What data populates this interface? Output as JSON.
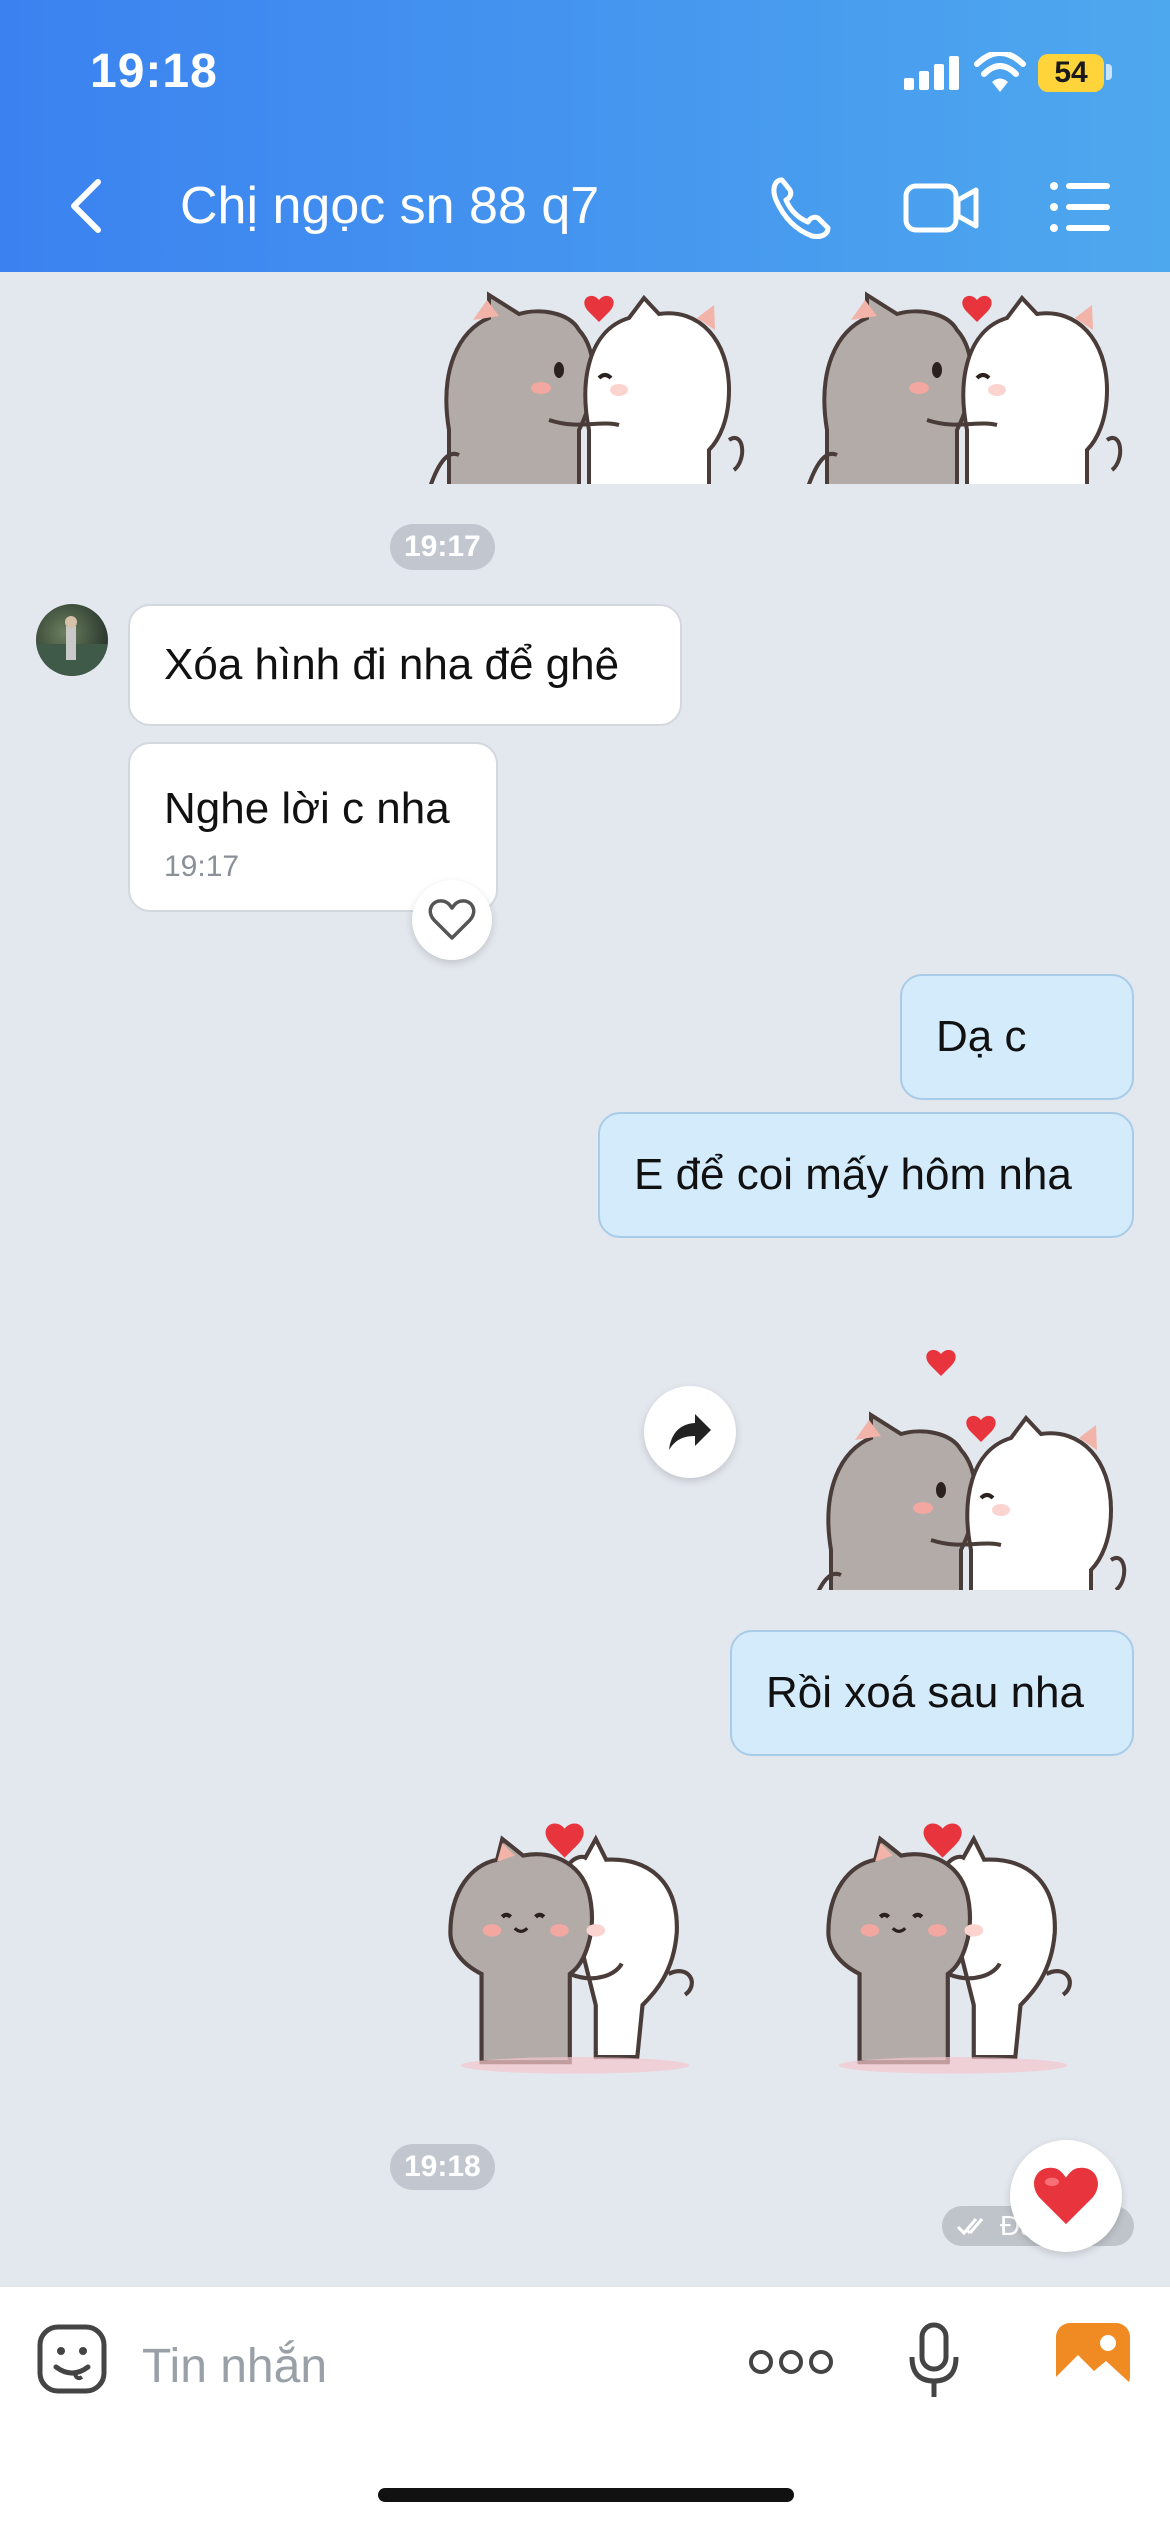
{
  "status_bar": {
    "time": "19:18",
    "battery": "54"
  },
  "header": {
    "title": "Chị ngọc sn 88 q7",
    "icons": [
      "back-icon",
      "phone-icon",
      "video-call-icon",
      "menu-list-icon"
    ]
  },
  "messages": {
    "timestamp_1": "19:17",
    "incoming_1": "Xóa hình đi nha để ghê",
    "incoming_2": "Nghe lời c nha",
    "incoming_2_time": "19:17",
    "outgoing_1": "Dạ c",
    "outgoing_2": "E để coi mấy hôm nha",
    "outgoing_3": "Rồi xoá sau nha",
    "timestamp_2": "19:18",
    "delivery_status": "Đã nhận"
  },
  "input": {
    "placeholder": "Tin nhắn",
    "icons": [
      "sticker-icon",
      "more-icon",
      "microphone-icon",
      "gallery-icon"
    ]
  },
  "colors": {
    "header_start": "#3b82f0",
    "header_end": "#4ea8ee",
    "chat_background": "#e3e7ee",
    "outgoing_bubble": "#d4ebfc",
    "incoming_bubble": "#ffffff",
    "heart": "#e8343c",
    "gallery_icon": "#f08a22"
  }
}
